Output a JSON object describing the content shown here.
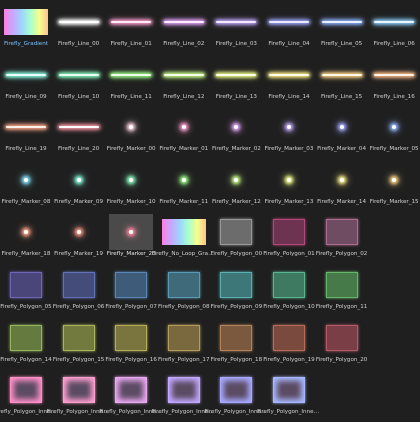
{
  "items": [
    {
      "label": "Firefly_Gradient",
      "kind": "gradient",
      "selected": true
    },
    {
      "label": "Firefly_Line_00",
      "kind": "line",
      "color": "#ffffff",
      "glow": "#ffffff"
    },
    {
      "label": "Firefly_Line_01",
      "kind": "line",
      "color": "#ffe9f3",
      "glow": "#ff9fd0"
    },
    {
      "label": "Firefly_Line_02",
      "kind": "line",
      "color": "#ffe9ff",
      "glow": "#e6a8ff"
    },
    {
      "label": "Firefly_Line_03",
      "kind": "line",
      "color": "#f3e9ff",
      "glow": "#c2a8ff"
    },
    {
      "label": "Firefly_Line_04",
      "kind": "line",
      "color": "#ece9ff",
      "glow": "#9fa8ff"
    },
    {
      "label": "Firefly_Line_05",
      "kind": "line",
      "color": "#e9f0ff",
      "glow": "#8fb4ff"
    },
    {
      "label": "Firefly_Line_06",
      "kind": "line",
      "color": "#e9f6ff",
      "glow": "#8fd0ff"
    },
    {
      "label": "Firefly_Line_09",
      "kind": "line",
      "color": "#e9fffb",
      "glow": "#88ffe0"
    },
    {
      "label": "Firefly_Line_10",
      "kind": "line",
      "color": "#e9fff4",
      "glow": "#88ffc0"
    },
    {
      "label": "Firefly_Line_11",
      "kind": "line",
      "color": "#edffe9",
      "glow": "#9dff88"
    },
    {
      "label": "Firefly_Line_12",
      "kind": "line",
      "color": "#f5ffe9",
      "glow": "#c9ff88"
    },
    {
      "label": "Firefly_Line_13",
      "kind": "line",
      "color": "#fbffe9",
      "glow": "#f0ff88"
    },
    {
      "label": "Firefly_Line_14",
      "kind": "line",
      "color": "#fffde9",
      "glow": "#fff088"
    },
    {
      "label": "Firefly_Line_15",
      "kind": "line",
      "color": "#fff8e9",
      "glow": "#ffd688"
    },
    {
      "label": "Firefly_Line_16",
      "kind": "line",
      "color": "#fff3e9",
      "glow": "#ffbf88"
    },
    {
      "label": "Firefly_Line_19",
      "kind": "line",
      "color": "#fff0e9",
      "glow": "#ffa888"
    },
    {
      "label": "Firefly_Line_20",
      "kind": "line",
      "color": "#ffffff",
      "glow": "#ff9aa8"
    },
    {
      "label": "Firefly_Marker_00",
      "kind": "marker",
      "color": "#ffffff",
      "glow": "#ffd0e0"
    },
    {
      "label": "Firefly_Marker_01",
      "kind": "marker",
      "color": "#ffffff",
      "glow": "#ff9fd0"
    },
    {
      "label": "Firefly_Marker_02",
      "kind": "marker",
      "color": "#ffffff",
      "glow": "#e6a8ff"
    },
    {
      "label": "Firefly_Marker_03",
      "kind": "marker",
      "color": "#ffffff",
      "glow": "#c2a8ff"
    },
    {
      "label": "Firefly_Marker_04",
      "kind": "marker",
      "color": "#ffffff",
      "glow": "#9fa8ff"
    },
    {
      "label": "Firefly_Marker_05",
      "kind": "marker",
      "color": "#ffffff",
      "glow": "#8fb4ff"
    },
    {
      "label": "Firefly_Marker_08",
      "kind": "marker",
      "color": "#ffffff",
      "glow": "#88e8ff"
    },
    {
      "label": "Firefly_Marker_09",
      "kind": "marker",
      "color": "#ffffff",
      "glow": "#88ffe0"
    },
    {
      "label": "Firefly_Marker_10",
      "kind": "marker",
      "color": "#ffffff",
      "glow": "#88ffc0"
    },
    {
      "label": "Firefly_Marker_11",
      "kind": "marker",
      "color": "#ffffff",
      "glow": "#9dff88"
    },
    {
      "label": "Firefly_Marker_12",
      "kind": "marker",
      "color": "#ffffff",
      "glow": "#c9ff88"
    },
    {
      "label": "Firefly_Marker_13",
      "kind": "marker",
      "color": "#ffffff",
      "glow": "#f0ff88"
    },
    {
      "label": "Firefly_Marker_14",
      "kind": "marker",
      "color": "#ffffff",
      "glow": "#fff088"
    },
    {
      "label": "Firefly_Marker_15",
      "kind": "marker",
      "color": "#ffffff",
      "glow": "#ffd688"
    },
    {
      "label": "Firefly_Marker_18",
      "kind": "marker",
      "color": "#ffffff",
      "glow": "#ffa888"
    },
    {
      "label": "Firefly_Marker_19",
      "kind": "marker",
      "color": "#ffffff",
      "glow": "#ff9a8a"
    },
    {
      "label": "Firefly_Marker_20",
      "kind": "marker",
      "color": "#ffffff",
      "glow": "#ff8aa0",
      "hover": true
    },
    {
      "label": "Firefly_No_Loop_Gradient",
      "kind": "gradient"
    },
    {
      "label": "Firefly_Polygon_00",
      "kind": "poly",
      "color": "#9a9a9a",
      "fill": "#6c6c6c"
    },
    {
      "label": "Firefly_Polygon_01",
      "kind": "poly",
      "color": "#b0487a",
      "fill": "#6e3350"
    },
    {
      "label": "Firefly_Polygon_02",
      "kind": "poly",
      "color": "#b06c8f",
      "fill": "#704c63"
    },
    {
      "label": "",
      "kind": "empty"
    },
    {
      "label": "Firefly_Polygon_05",
      "kind": "poly",
      "color": "#6e67b5",
      "fill": "#4a467a"
    },
    {
      "label": "Firefly_Polygon_06",
      "kind": "poly",
      "color": "#6470b5",
      "fill": "#444d7a"
    },
    {
      "label": "Firefly_Polygon_07",
      "kind": "poly",
      "color": "#5a86b5",
      "fill": "#3e5b7a"
    },
    {
      "label": "Firefly_Polygon_08",
      "kind": "poly",
      "color": "#5a9ab5",
      "fill": "#3e6a7a"
    },
    {
      "label": "Firefly_Polygon_09",
      "kind": "poly",
      "color": "#5ab0b0",
      "fill": "#3e7777"
    },
    {
      "label": "Firefly_Polygon_10",
      "kind": "poly",
      "color": "#5ab58e",
      "fill": "#3e7a61"
    },
    {
      "label": "Firefly_Polygon_11",
      "kind": "poly",
      "color": "#67b56a",
      "fill": "#467a48"
    },
    {
      "label": "",
      "kind": "empty"
    },
    {
      "label": "Firefly_Polygon_14",
      "kind": "poly",
      "color": "#95b55a",
      "fill": "#657a3e"
    },
    {
      "label": "Firefly_Polygon_15",
      "kind": "poly",
      "color": "#a8b55a",
      "fill": "#727a3e"
    },
    {
      "label": "Firefly_Polygon_16",
      "kind": "poly",
      "color": "#b5ad5a",
      "fill": "#7a743e"
    },
    {
      "label": "Firefly_Polygon_17",
      "kind": "poly",
      "color": "#b59c5a",
      "fill": "#7a693e"
    },
    {
      "label": "Firefly_Polygon_18",
      "kind": "poly",
      "color": "#b5835a",
      "fill": "#7a593e"
    },
    {
      "label": "Firefly_Polygon_19",
      "kind": "poly",
      "color": "#b56d5a",
      "fill": "#7a4a3e"
    },
    {
      "label": "Firefly_Polygon_20",
      "kind": "poly",
      "color": "#b55a67",
      "fill": "#7a3e47"
    },
    {
      "label": "",
      "kind": "empty"
    },
    {
      "label": "Firefly_Polygon_Inner_01",
      "kind": "inner",
      "color": "#ff8fc8"
    },
    {
      "label": "Firefly_Polygon_Inner_02",
      "kind": "inner",
      "color": "#ff9fd0"
    },
    {
      "label": "Firefly_Polygon_Inner_03",
      "kind": "inner",
      "color": "#e9a8f0"
    },
    {
      "label": "Firefly_Polygon_Inner_04",
      "kind": "inner",
      "color": "#c2a8ff"
    },
    {
      "label": "Firefly_Polygon_Inner_05",
      "kind": "inner",
      "color": "#a8a8ff"
    },
    {
      "label": "Firefly_Polygon_Inner_06",
      "kind": "inner",
      "color": "#a8b8ff"
    }
  ],
  "gradient_colors": [
    "#ff7fe1",
    "#c7a7ff",
    "#9fd3ff",
    "#a8ffcf",
    "#f6ff8d",
    "#ffc38e"
  ]
}
